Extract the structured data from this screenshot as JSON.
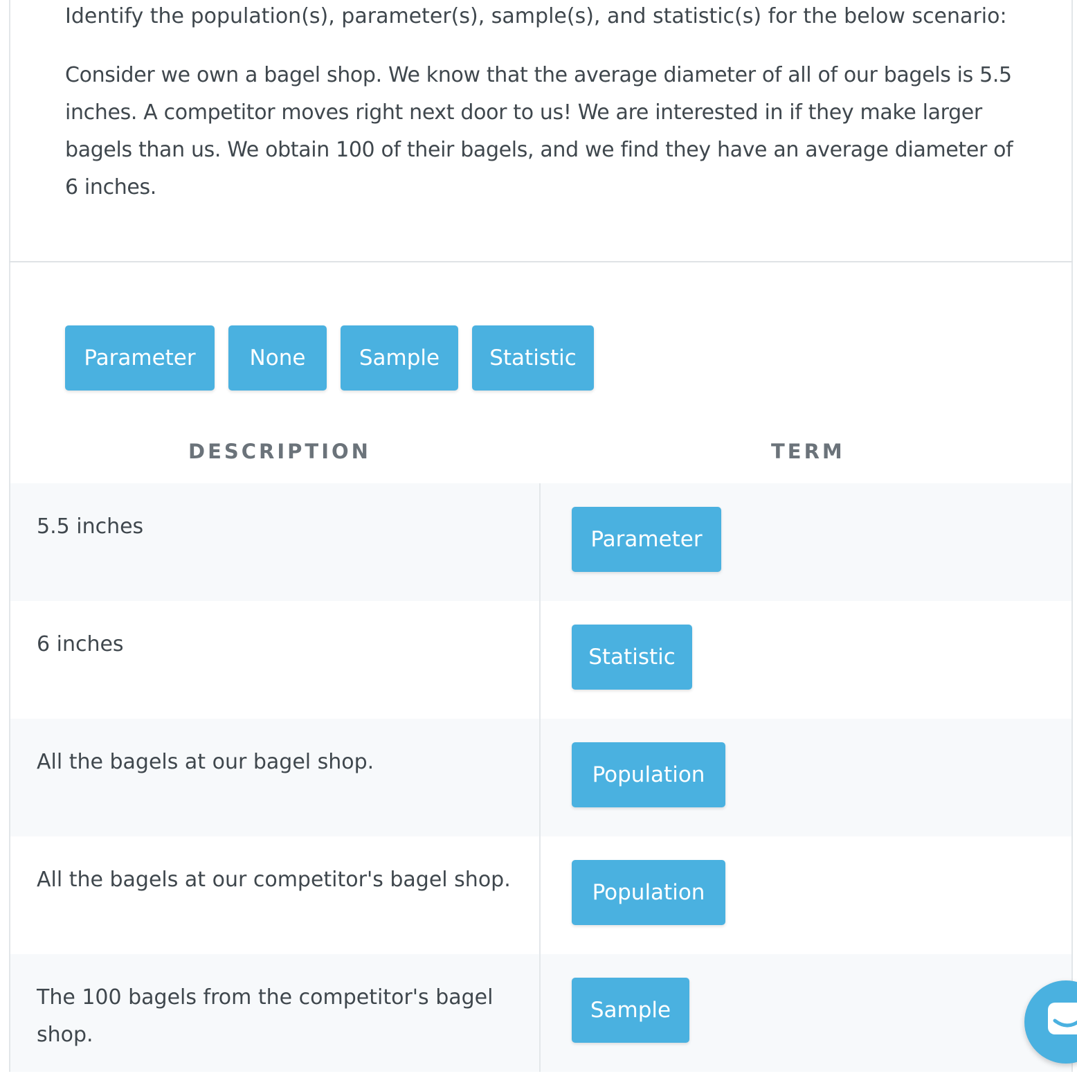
{
  "question": {
    "prompt": "Identify the population(s), parameter(s), sample(s), and statistic(s) for the below scenario:",
    "scenario": "Consider we own a bagel shop. We know that the average diameter of all of our bagels is 5.5 inches. A competitor moves right next door to us! We are interested in if they make larger bagels than us. We obtain 100 of their bagels, and we find they have an average diameter of 6 inches."
  },
  "answer_bank": {
    "chips": [
      "Parameter",
      "None",
      "Sample",
      "Statistic"
    ]
  },
  "table": {
    "headers": {
      "description": "DESCRIPTION",
      "term": "TERM"
    },
    "rows": [
      {
        "description": "5.5 inches",
        "term": "Parameter"
      },
      {
        "description": "6 inches",
        "term": "Statistic"
      },
      {
        "description": "All the bagels at our bagel shop.",
        "term": "Population"
      },
      {
        "description": "All the bagels at our competitor's bagel shop.",
        "term": "Population"
      },
      {
        "description": "The 100 bagels from the competitor's bagel shop.",
        "term": "Sample"
      }
    ]
  },
  "chat_widget": {
    "icon": "chat-bubble-icon"
  },
  "colors": {
    "accent": "#4ab1e0",
    "text": "#3f474d",
    "header_text": "#6b737a",
    "row_alt": "#f7f9fb"
  }
}
